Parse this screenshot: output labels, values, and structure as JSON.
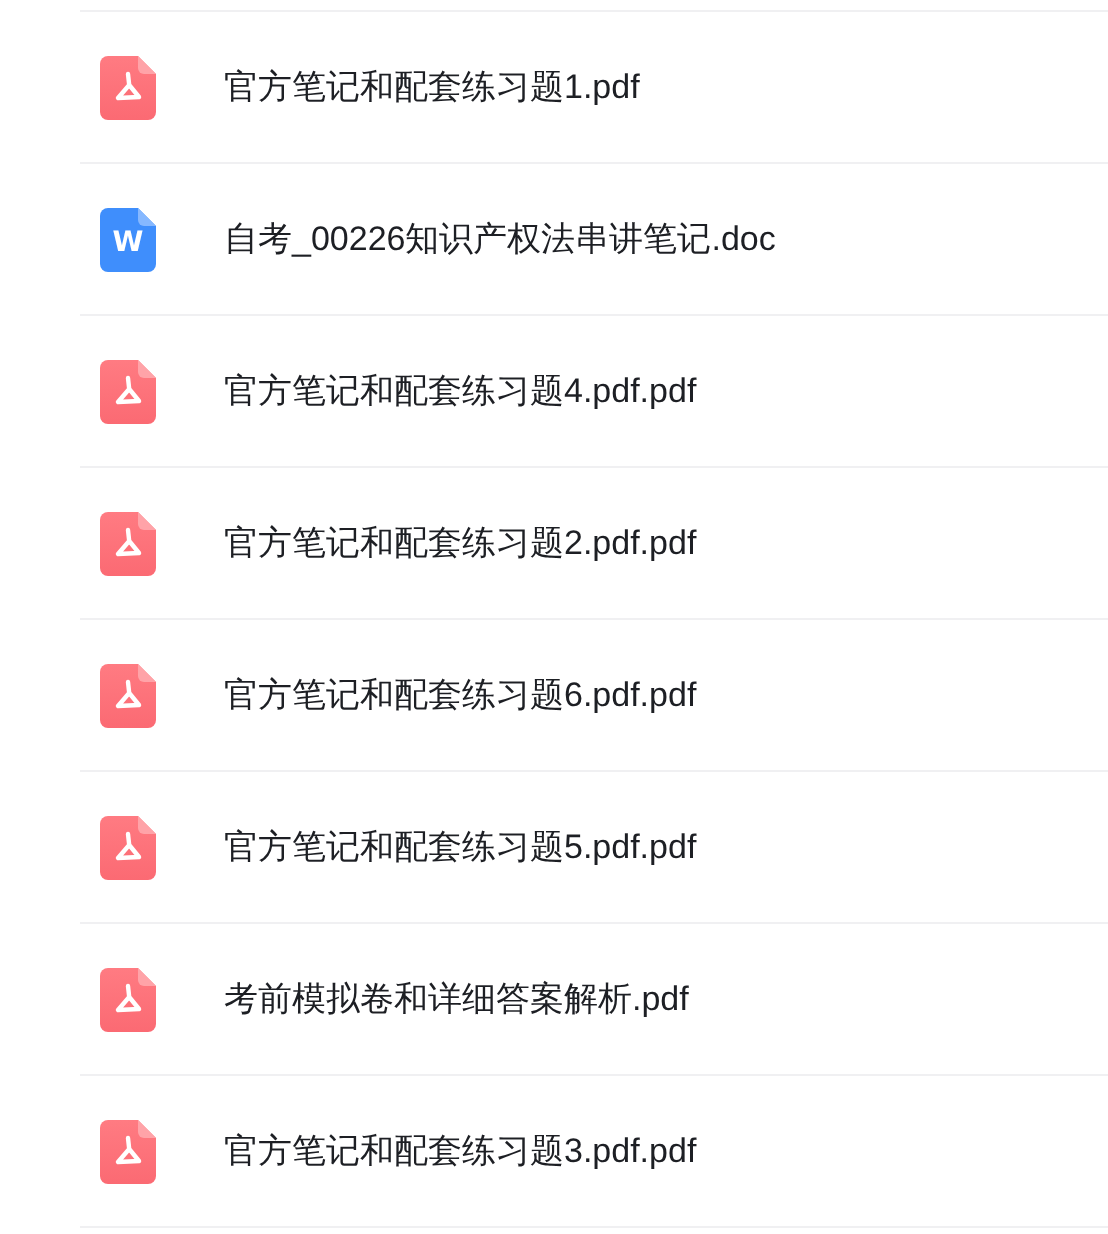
{
  "files": [
    {
      "kind": "pdf",
      "name": "官方笔记和配套练习题1.pdf"
    },
    {
      "kind": "doc",
      "icon_text": "W",
      "name": "自考_00226知识产权法串讲笔记.doc"
    },
    {
      "kind": "pdf",
      "name": "官方笔记和配套练习题4.pdf.pdf"
    },
    {
      "kind": "pdf",
      "name": "官方笔记和配套练习题2.pdf.pdf"
    },
    {
      "kind": "pdf",
      "name": "官方笔记和配套练习题6.pdf.pdf"
    },
    {
      "kind": "pdf",
      "name": "官方笔记和配套练习题5.pdf.pdf"
    },
    {
      "kind": "pdf",
      "name": "考前模拟卷和详细答案解析.pdf"
    },
    {
      "kind": "pdf",
      "name": "官方笔记和配套练习题3.pdf.pdf"
    }
  ]
}
